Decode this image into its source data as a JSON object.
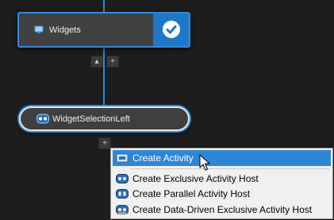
{
  "colors": {
    "accent": "#2f8ad8",
    "check_bg": "#1e78c8",
    "menu_highlight": "#2e86d4",
    "canvas_bg": "#1d1d1d",
    "node_bg": "#414141"
  },
  "nodes": {
    "widgets": {
      "label": "Widgets",
      "icon": "monitor-icon",
      "status_icon": "check-circle-icon"
    },
    "widget_selection_left": {
      "label": "WidgetSelectionLeft",
      "icon": "activity-host-icon"
    }
  },
  "buttons": {
    "collapse_glyph": "▴",
    "add_glyph": "+",
    "add_below_glyph": "+"
  },
  "context_menu": {
    "items": [
      {
        "label": "Create Activity",
        "icon": "activity-icon",
        "highlighted": true
      },
      {
        "label": "Create Exclusive Activity Host",
        "icon": "exclusive-host-icon"
      },
      {
        "label": "Create Parallel Activity Host",
        "icon": "parallel-host-icon"
      },
      {
        "label": "Create Data-Driven Exclusive Activity Host",
        "icon": "data-driven-host-icon"
      }
    ]
  }
}
